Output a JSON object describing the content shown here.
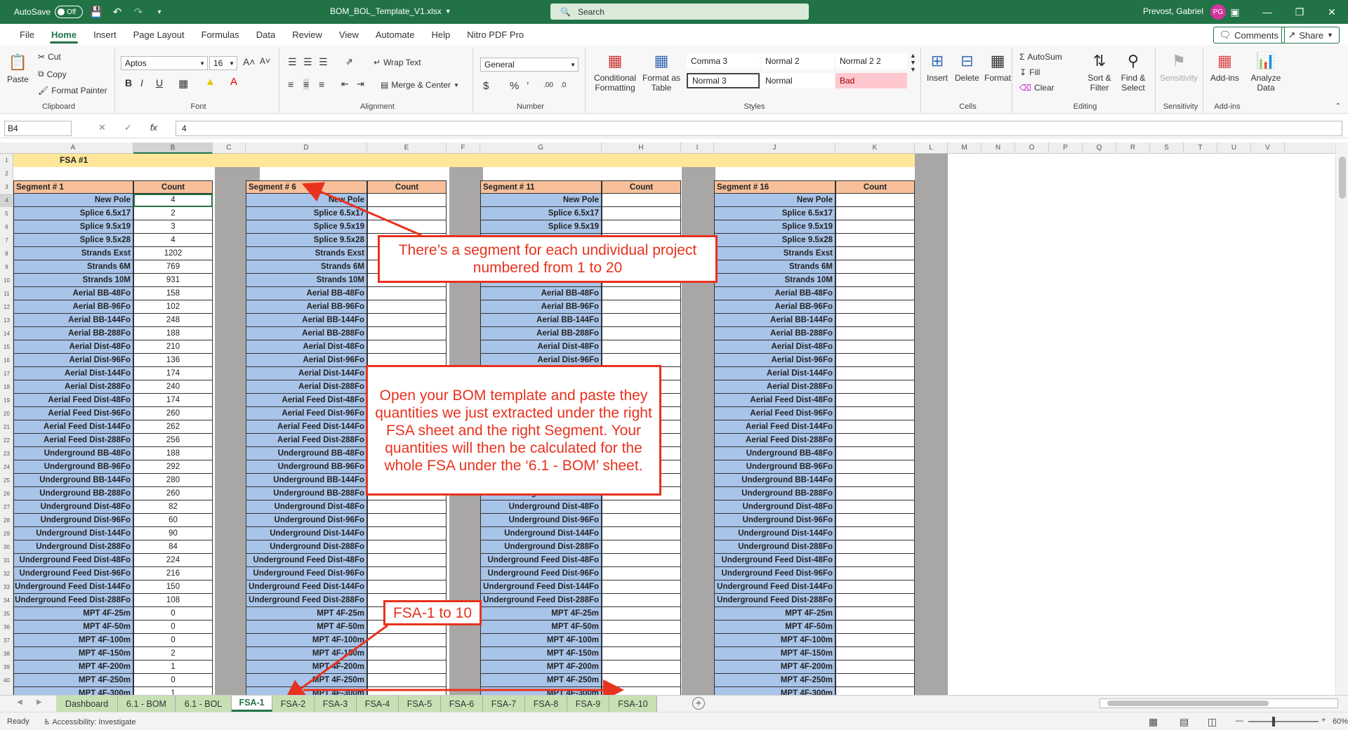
{
  "titlebar": {
    "autosave": "AutoSave",
    "autosave_state": "Off",
    "filename": "BOM_BOL_Template_V1.xlsx",
    "search": "Search",
    "user": "Prevost, Gabriel",
    "initials": "PG"
  },
  "menu": {
    "tabs": [
      "File",
      "Home",
      "Insert",
      "Page Layout",
      "Formulas",
      "Data",
      "Review",
      "View",
      "Automate",
      "Help",
      "Nitro PDF Pro"
    ],
    "comments": "Comments",
    "share": "Share"
  },
  "ribbon": {
    "clipboard": {
      "label": "Clipboard",
      "paste": "Paste",
      "cut": "Cut",
      "copy": "Copy",
      "format_painter": "Format Painter"
    },
    "font": {
      "label": "Font",
      "name": "Aptos",
      "size": "16"
    },
    "alignment": {
      "label": "Alignment",
      "wrap": "Wrap Text",
      "merge": "Merge & Center"
    },
    "number": {
      "label": "Number",
      "format": "General"
    },
    "styles": {
      "label": "Styles",
      "conditional": "Conditional Formatting",
      "format_table": "Format as Table",
      "cells": [
        "Comma 3",
        "Normal 2",
        "Normal 2 2",
        "Normal 3",
        "Normal",
        "Bad"
      ]
    },
    "cells": {
      "label": "Cells",
      "insert": "Insert",
      "delete": "Delete",
      "format": "Format"
    },
    "editing": {
      "label": "Editing",
      "autosum": "AutoSum",
      "fill": "Fill",
      "clear": "Clear",
      "sort": "Sort & Filter",
      "find": "Find & Select"
    },
    "sensitivity": {
      "label": "Sensitivity",
      "btn": "Sensitivity"
    },
    "addins": {
      "label": "Add-ins",
      "btn": "Add-ins",
      "analyze": "Analyze Data"
    }
  },
  "formula_bar": {
    "name_box": "B4",
    "value": "4"
  },
  "grid": {
    "columns": [
      "A",
      "B",
      "C",
      "D",
      "E",
      "F",
      "G",
      "H",
      "I",
      "J",
      "K",
      "L",
      "M",
      "N",
      "O",
      "P",
      "Q",
      "R",
      "S",
      "T",
      "U",
      "V"
    ],
    "fsa_title": "FSA #1",
    "count_header": "Count",
    "segments": [
      "Segment # 1",
      "Segment # 6",
      "Segment # 11",
      "Segment # 16"
    ],
    "items": [
      "New Pole",
      "Splice 6.5x17",
      "Splice 9.5x19",
      "Splice 9.5x28",
      "Strands Exst",
      "Strands 6M",
      "Strands 10M",
      "Aerial BB-48Fo",
      "Aerial BB-96Fo",
      "Aerial BB-144Fo",
      "Aerial BB-288Fo",
      "Aerial Dist-48Fo",
      "Aerial Dist-96Fo",
      "Aerial Dist-144Fo",
      "Aerial Dist-288Fo",
      "Aerial Feed Dist-48Fo",
      "Aerial Feed Dist-96Fo",
      "Aerial Feed Dist-144Fo",
      "Aerial Feed Dist-288Fo",
      "Underground BB-48Fo",
      "Underground BB-96Fo",
      "Underground BB-144Fo",
      "Underground BB-288Fo",
      "Underground Dist-48Fo",
      "Underground Dist-96Fo",
      "Underground Dist-144Fo",
      "Underground Dist-288Fo",
      "Underground Feed Dist-48Fo",
      "Underground Feed Dist-96Fo",
      "Underground Feed Dist-144Fo",
      "Underground Feed Dist-288Fo",
      "MPT 4F-25m",
      "MPT 4F-50m",
      "MPT 4F-100m",
      "MPT 4F-150m",
      "MPT 4F-200m",
      "MPT 4F-250m",
      "MPT 4F-300m"
    ],
    "segment1_counts": [
      "4",
      "2",
      "3",
      "4",
      "1202",
      "769",
      "931",
      "158",
      "102",
      "248",
      "188",
      "210",
      "136",
      "174",
      "240",
      "174",
      "260",
      "262",
      "256",
      "188",
      "292",
      "280",
      "260",
      "82",
      "60",
      "90",
      "84",
      "224",
      "216",
      "150",
      "108",
      "0",
      "0",
      "0",
      "2",
      "1",
      "0",
      "1"
    ]
  },
  "annotations": {
    "note1": "There’s a segment for each undividual project numbered from 1 to 20",
    "note2": "Open your BOM template and paste they quantities we just extracted under the right FSA sheet and the right Segment. Your quantities will then be calculated for the whole FSA under the ‘6.1 - BOM’ sheet.",
    "note3": "FSA-1 to 10"
  },
  "sheets": [
    "Dashboard",
    "6.1 - BOM",
    "6.1 - BOL",
    "FSA-1",
    "FSA-2",
    "FSA-3",
    "FSA-4",
    "FSA-5",
    "FSA-6",
    "FSA-7",
    "FSA-8",
    "FSA-9",
    "FSA-10"
  ],
  "active_sheet": "FSA-1",
  "status": {
    "ready": "Ready",
    "accessibility": "Accessibility: Investigate",
    "zoom": "60%"
  },
  "colors": {
    "excel_green": "#217346",
    "label_blue": "#a9c4e9",
    "header_orange": "#f7c09a",
    "title_yellow": "#ffe699",
    "annotation_red": "#e8321e",
    "sheet_tab_green": "#c6e0b4"
  }
}
